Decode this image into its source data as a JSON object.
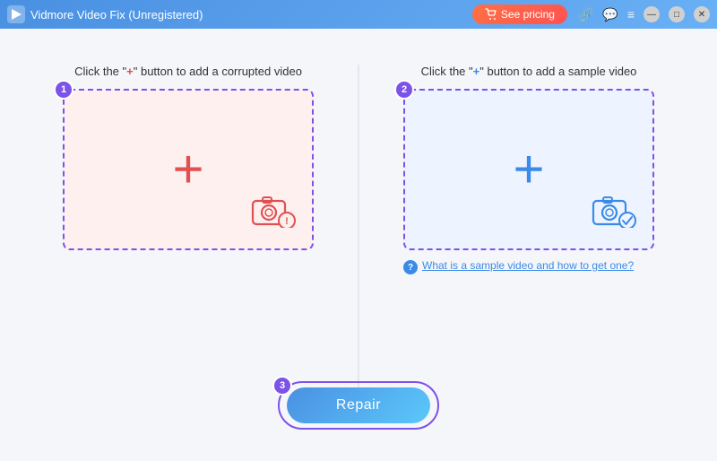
{
  "titleBar": {
    "title": "Vidmore Video Fix (Unregistered)",
    "pricingButton": "See pricing",
    "logoIcon": "vidmore-logo",
    "linkIcon": "link-icon",
    "chatIcon": "chat-icon",
    "menuIcon": "menu-icon"
  },
  "windowControls": {
    "minimize": "—",
    "maximize": "□",
    "close": "✕"
  },
  "corrupted": {
    "instruction": "Click the \"+\" button to add a corrupted video",
    "plusLabel": "+",
    "stepBadge": "1",
    "cameraIcon": "camera-error-icon"
  },
  "sample": {
    "instruction": "Click the \"+\" button to add a sample video",
    "plusLabel": "+",
    "stepBadge": "2",
    "cameraIcon": "camera-ok-icon",
    "infoText": "What is a sample video and how to get one?"
  },
  "repair": {
    "buttonLabel": "Repair",
    "stepBadge": "3"
  }
}
